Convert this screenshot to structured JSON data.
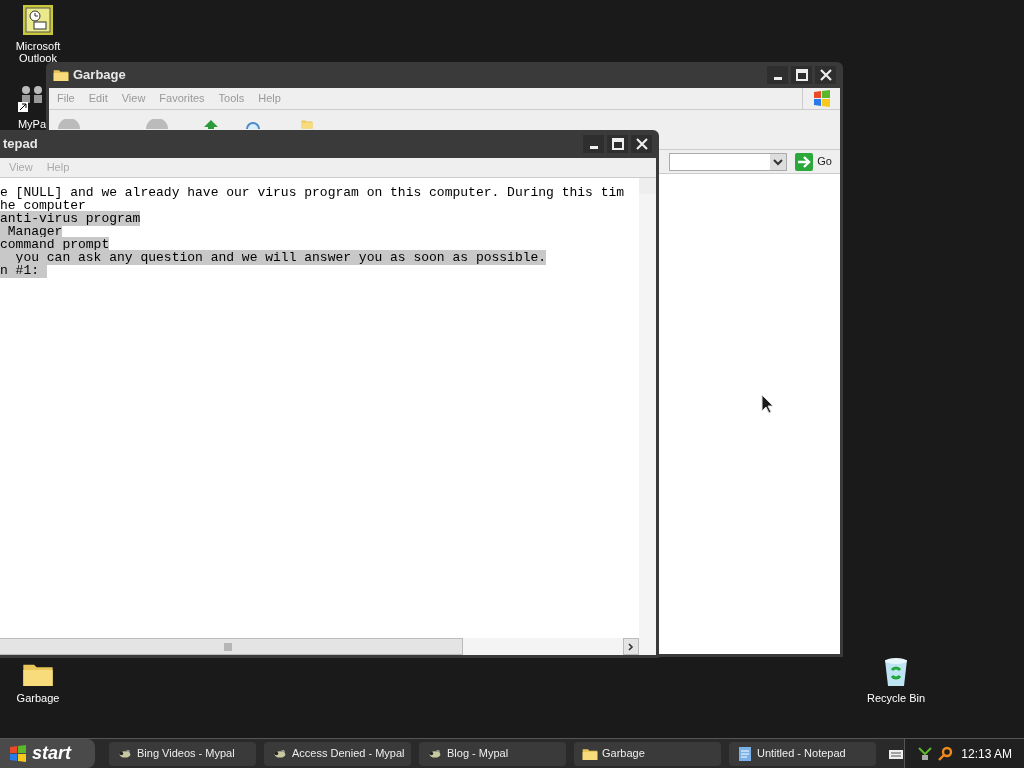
{
  "desktop_icons": [
    {
      "kind": "outlook",
      "label": "Microsoft Outlook"
    },
    {
      "kind": "shortcut",
      "label": "MyPa"
    },
    {
      "kind": "folder",
      "label": "Garbage"
    },
    {
      "kind": "recycle",
      "label": "Recycle Bin"
    }
  ],
  "explorer_window": {
    "title": "Garbage",
    "menu": [
      "File",
      "Edit",
      "View",
      "Favorites",
      "Tools",
      "Help"
    ],
    "go_label": "Go"
  },
  "notepad_window": {
    "title": "tepad",
    "menu": [
      "View",
      "Help"
    ],
    "lines": [
      {
        "text": "e [NULL] and we already have our virus program on this computer. During this tim",
        "selected": false
      },
      {
        "text": "he computer",
        "selected": false
      },
      {
        "text": "anti-virus program",
        "selected": true
      },
      {
        "text": " Manager",
        "selected": true
      },
      {
        "text": "command prompt",
        "selected": true
      },
      {
        "text": "  you can ask any question and we will answer you as soon as possible.",
        "selected": true
      },
      {
        "text": "n #1: ",
        "selected": true
      }
    ]
  },
  "taskbar": {
    "start": "start",
    "tasks": [
      {
        "kind": "browser",
        "label": "Bing Videos - Mypal"
      },
      {
        "kind": "browser",
        "label": "Access Denied - Mypal"
      },
      {
        "kind": "browser",
        "label": "Blog - Mypal"
      },
      {
        "kind": "folder",
        "label": "Garbage"
      },
      {
        "kind": "notepad",
        "label": "Untitled - Notepad"
      }
    ],
    "clock": "12:13 AM"
  }
}
